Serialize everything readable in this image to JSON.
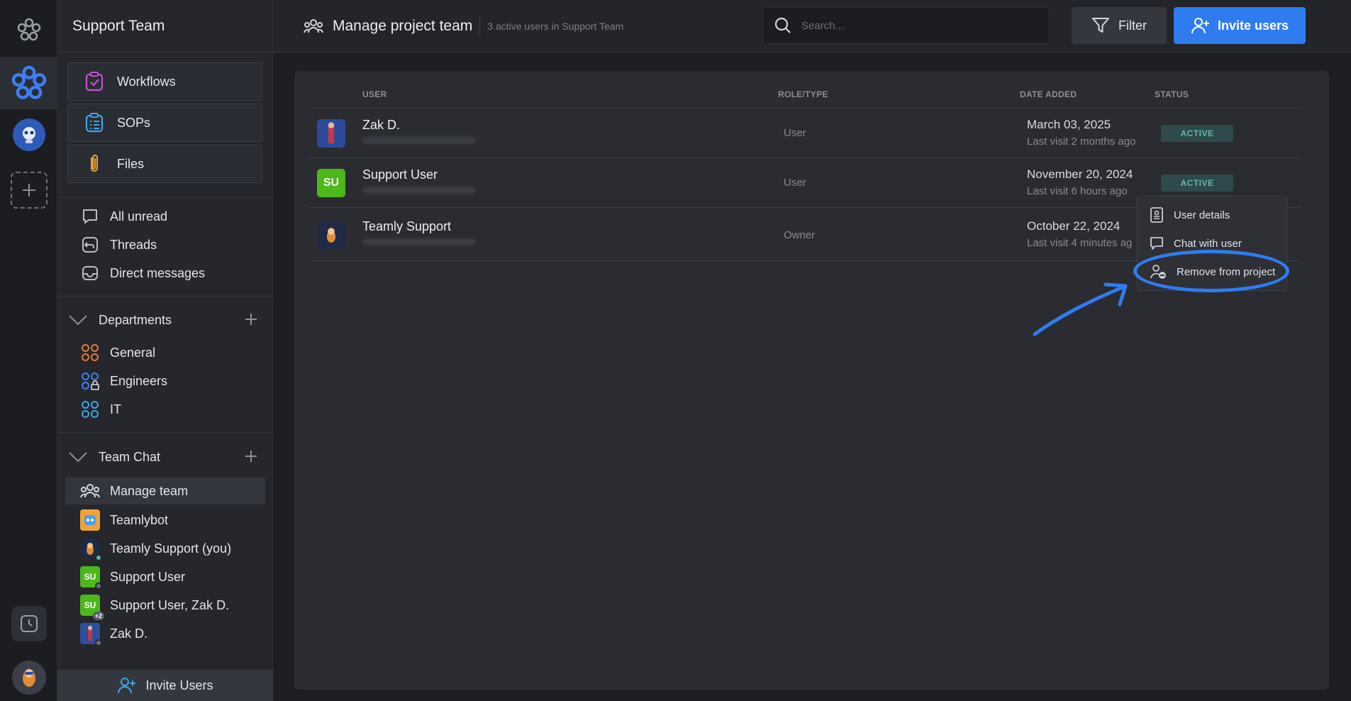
{
  "sidebar": {
    "title": "Support Team",
    "cards": [
      {
        "label": "Workflows",
        "icon": "workflow-icon"
      },
      {
        "label": "SOPs",
        "icon": "clipboard-icon"
      },
      {
        "label": "Files",
        "icon": "paperclip-icon"
      }
    ],
    "nav": [
      {
        "label": "All unread",
        "icon": "chat-bubble-icon"
      },
      {
        "label": "Threads",
        "icon": "threads-icon"
      },
      {
        "label": "Direct messages",
        "icon": "inbox-icon"
      }
    ],
    "departments": {
      "title": "Departments",
      "items": [
        {
          "label": "General",
          "color": "#e07a3a"
        },
        {
          "label": "Engineers",
          "color": "#3b82f6"
        },
        {
          "label": "IT",
          "color": "#3ea6e8"
        }
      ]
    },
    "team_chat": {
      "title": "Team Chat",
      "items": [
        {
          "label": "Manage team",
          "selected": true
        },
        {
          "label": "Teamlybot"
        },
        {
          "label": "Teamly Support (you)"
        },
        {
          "label": "Support User",
          "avatar_text": "SU"
        },
        {
          "label": "Support User, Zak D.",
          "avatar_text": "SU",
          "badge": "+2"
        },
        {
          "label": "Zak D."
        }
      ]
    },
    "invite_label": "Invite Users"
  },
  "topbar": {
    "title": "Manage project team",
    "subtitle": "3 active users in Support Team",
    "search_placeholder": "Search...",
    "filter_label": "Filter",
    "invite_label": "Invite users"
  },
  "table": {
    "headers": {
      "user": "USER",
      "role": "ROLE/TYPE",
      "date": "DATE ADDED",
      "status": "STATUS"
    },
    "rows": [
      {
        "name": "Zak D.",
        "role": "User",
        "date": "March 03, 2025",
        "visit": "Last visit 2 months ago",
        "status": "ACTIVE"
      },
      {
        "name": "Support User",
        "avatar_text": "SU",
        "role": "User",
        "date": "November 20, 2024",
        "visit": "Last visit 6 hours ago",
        "status": "ACTIVE"
      },
      {
        "name": "Teamly Support",
        "role": "Owner",
        "date": "October 22, 2024",
        "visit": "Last visit 4 minutes ag"
      }
    ]
  },
  "context_menu": {
    "items": [
      {
        "label": "User details",
        "icon": "user-card-icon"
      },
      {
        "label": "Chat with user",
        "icon": "chat-icon"
      },
      {
        "label": "Remove from project",
        "icon": "user-remove-icon"
      }
    ]
  },
  "colors": {
    "accent": "#2f7cf0",
    "active_badge_bg": "#2e4a4d",
    "active_badge_text": "#62b7ac",
    "su_green": "#4cb81b"
  }
}
